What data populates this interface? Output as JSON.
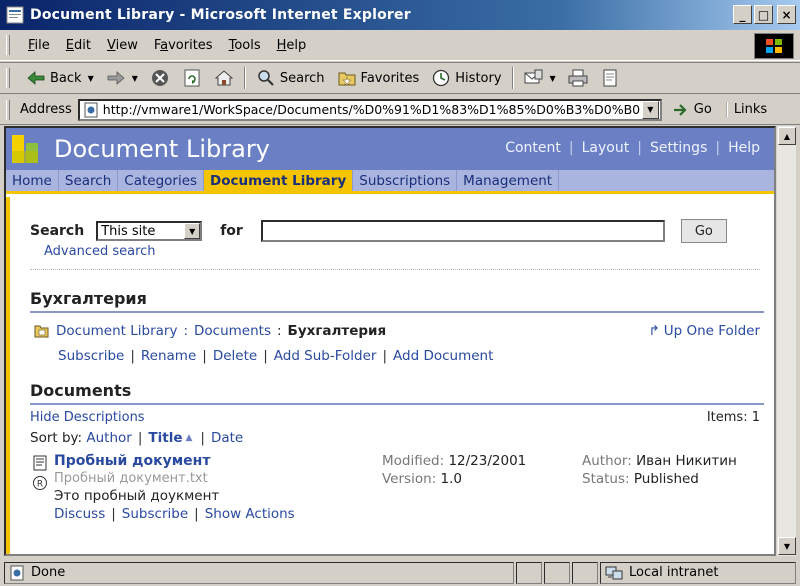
{
  "window": {
    "title": "Document Library - Microsoft Internet Explorer",
    "minimize": "_",
    "maximize": "□",
    "close": "×"
  },
  "menu": {
    "items": [
      {
        "accel": "F",
        "rest": "ile"
      },
      {
        "accel": "E",
        "rest": "dit"
      },
      {
        "accel": "V",
        "rest": "iew"
      },
      {
        "pre": "F",
        "accel": "a",
        "rest": "vorites"
      },
      {
        "accel": "T",
        "rest": "ools"
      },
      {
        "accel": "H",
        "rest": "elp"
      }
    ]
  },
  "toolbar": {
    "back": "Back",
    "search": "Search",
    "favorites": "Favorites",
    "history": "History"
  },
  "address": {
    "label": "Address",
    "url": "http://vmware1/WorkSpace/Documents/%D0%91%D1%83%D1%85%D0%B3%D0%B0",
    "go": "Go",
    "links": "Links"
  },
  "site": {
    "title": "Document Library",
    "header_links": [
      "Content",
      "Layout",
      "Settings",
      "Help"
    ],
    "nav_tabs": [
      "Home",
      "Search",
      "Categories",
      "Document Library",
      "Subscriptions",
      "Management"
    ],
    "active_tab": "Document Library"
  },
  "search": {
    "label": "Search",
    "scope": "This site",
    "for_label": "for",
    "query": "",
    "go": "Go",
    "advanced": "Advanced search"
  },
  "folder": {
    "heading": "Бухгалтерия",
    "breadcrumb": [
      "Document Library",
      "Documents"
    ],
    "current": "Бухгалтерия",
    "up_folder": "Up One Folder",
    "actions": [
      "Subscribe",
      "Rename",
      "Delete",
      "Add Sub-Folder",
      "Add Document"
    ]
  },
  "documents": {
    "heading": "Documents",
    "hide_descriptions": "Hide Descriptions",
    "items_label": "Items:",
    "items_count": "1",
    "sort_label": "Sort by:",
    "sort_author": "Author",
    "sort_title": "Title",
    "sort_date": "Date",
    "list": [
      {
        "title": "Пробный документ",
        "filename": "Пробный документ.txt",
        "description": "Это пробный доукмент",
        "modified_label": "Modified:",
        "modified": "12/23/2001",
        "version_label": "Version:",
        "version": "1.0",
        "author_label": "Author:",
        "author": "Иван Никитин",
        "status_label": "Status:",
        "status": "Published",
        "actions": [
          "Discuss",
          "Subscribe",
          "Show Actions"
        ]
      }
    ]
  },
  "status": {
    "left": "Done",
    "zone": "Local intranet"
  },
  "colors": {
    "header_bg": "#6b80c4",
    "nav_bg": "#a9b4df",
    "accent_yellow": "#f5c400",
    "link": "#2a4aa0"
  }
}
